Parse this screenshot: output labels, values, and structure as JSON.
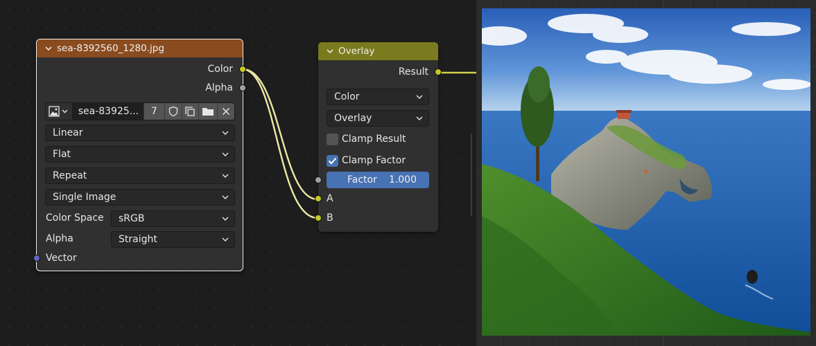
{
  "image_node": {
    "title": "sea-8392560_1280.jpg",
    "header_color": "#8a4b1e",
    "outputs": {
      "color": "Color",
      "alpha": "Alpha"
    },
    "image_name": "sea-83925...",
    "user_count": "7",
    "interpolation": "Linear",
    "projection": "Flat",
    "extension": "Repeat",
    "source": "Single Image",
    "color_space_label": "Color Space",
    "color_space": "sRGB",
    "alpha_label": "Alpha",
    "alpha_mode": "Straight",
    "vector_label": "Vector"
  },
  "overlay_node": {
    "title": "Overlay",
    "header_color": "#7a7a1e",
    "output": "Result",
    "data_type": "Color",
    "blend_type": "Overlay",
    "clamp_result_label": "Clamp Result",
    "clamp_result_checked": false,
    "clamp_factor_label": "Clamp Factor",
    "clamp_factor_checked": true,
    "factor_label": "Factor",
    "factor_value": "1.000",
    "input_a": "A",
    "input_b": "B"
  },
  "colors": {
    "socket_color": "#c7c729",
    "socket_float": "#a1a1a1",
    "socket_vector": "#6363c7",
    "accent_blue": "#4772b3",
    "wire": "#ece9a6"
  },
  "viewer": {
    "image_icon": "coastal-landscape-image"
  }
}
